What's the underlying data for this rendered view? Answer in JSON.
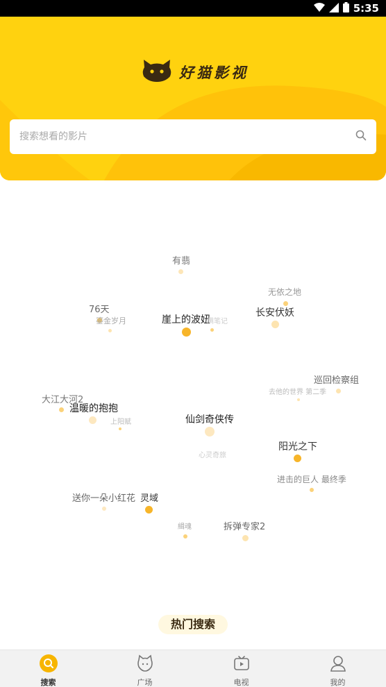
{
  "status_bar": {
    "time": "5:35",
    "icons": [
      "wifi-icon",
      "signal-icon",
      "battery-icon"
    ]
  },
  "header": {
    "app_name": "好猫影视",
    "logo_icon": "cat-head-icon",
    "search_placeholder": "搜索想看的影片",
    "search_icon": "search-icon",
    "colors": {
      "accent": "#ffd20f",
      "accent_dark": "#f7b500"
    }
  },
  "tag_cloud": {
    "items": [
      {
        "label": "有翡"
      },
      {
        "label": "无依之地"
      },
      {
        "label": "76天"
      },
      {
        "label": "鎏金岁月"
      },
      {
        "label": "崖上的波妞"
      },
      {
        "label": "瞒笔记"
      },
      {
        "label": "长安伏妖"
      },
      {
        "label": "巡回检察组"
      },
      {
        "label": "去他的世界 第二季"
      },
      {
        "label": "大江大河2"
      },
      {
        "label": "温暖的抱抱"
      },
      {
        "label": "上阳赋"
      },
      {
        "label": "仙剑奇侠传"
      },
      {
        "label": "心灵奇旅"
      },
      {
        "label": "阳光之下"
      },
      {
        "label": "进击的巨人 最终季"
      },
      {
        "label": "送你一朵小红花"
      },
      {
        "label": "灵域"
      },
      {
        "label": "拆弹专家2"
      },
      {
        "label": "緝魂"
      }
    ]
  },
  "hot_search_title": "热门搜索",
  "tabbar": {
    "tabs": [
      {
        "label": "搜索",
        "icon": "search-tab-icon",
        "active": true
      },
      {
        "label": "广场",
        "icon": "cat-face-tab-icon",
        "active": false
      },
      {
        "label": "电视",
        "icon": "tv-tab-icon",
        "active": false
      },
      {
        "label": "我的",
        "icon": "user-tab-icon",
        "active": false
      }
    ]
  }
}
